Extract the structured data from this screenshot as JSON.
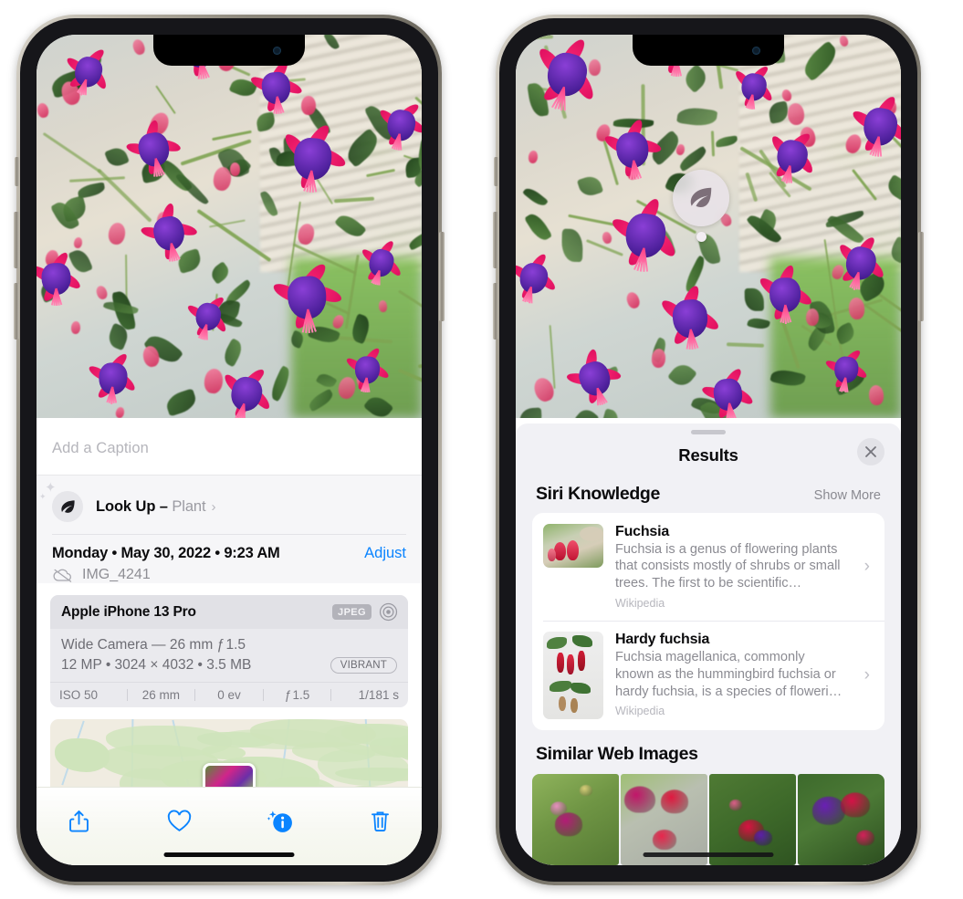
{
  "left_phone": {
    "device_name": "iPhone 13 Pro",
    "caption": {
      "placeholder": "Add a Caption",
      "value": ""
    },
    "lookup": {
      "label": "Look Up",
      "separator": " – ",
      "subject": "Plant",
      "chevron": "›",
      "icon": "leaf-icon"
    },
    "metadata": {
      "date_line": "Monday • May 30, 2022 • 9:23 AM",
      "adjust_label": "Adjust",
      "filename": "IMG_4241",
      "cloud_status_icon": "cloud-off-icon"
    },
    "exif": {
      "device": "Apple iPhone 13 Pro",
      "format_badge": "JPEG",
      "raw_icon": "aperture-icon",
      "lens_line": "Wide Camera — 26 mm ƒ 1.5",
      "size_line": "12 MP • 3024 × 4032 • 3.5 MB",
      "style_badge": "VIBRANT",
      "stats": [
        "ISO 50",
        "26 mm",
        "0 ev",
        "ƒ 1.5",
        "1/181 s"
      ]
    },
    "toolbar": [
      {
        "name": "share-button",
        "icon": "share-icon"
      },
      {
        "name": "favorite-button",
        "icon": "heart-icon"
      },
      {
        "name": "info-button",
        "icon": "info-sparkle-icon"
      },
      {
        "name": "delete-button",
        "icon": "trash-icon"
      }
    ],
    "accent_color": "#0a84ff"
  },
  "right_phone": {
    "visual_lookup_badge": {
      "icon": "leaf-icon",
      "tooltip": ""
    },
    "sheet": {
      "title": "Results",
      "close_icon": "close-icon",
      "sections": [
        {
          "title": "Siri Knowledge",
          "action": "Show More",
          "items": [
            {
              "title": "Fuchsia",
              "description": "Fuchsia is a genus of flowering plants that consists mostly of shrubs or small trees. The first to be scientific…",
              "source": "Wikipedia",
              "chevron": "›"
            },
            {
              "title": "Hardy fuchsia",
              "description": "Fuchsia magellanica, commonly known as the hummingbird fuchsia or hardy fuchsia, is a species of floweri…",
              "source": "Wikipedia",
              "chevron": "›"
            }
          ]
        },
        {
          "title": "Similar Web Images",
          "images": [
            {
              "alt": "fuchsia-thumb-1"
            },
            {
              "alt": "fuchsia-thumb-2"
            },
            {
              "alt": "fuchsia-thumb-3"
            },
            {
              "alt": "fuchsia-thumb-4"
            }
          ]
        }
      ]
    }
  }
}
